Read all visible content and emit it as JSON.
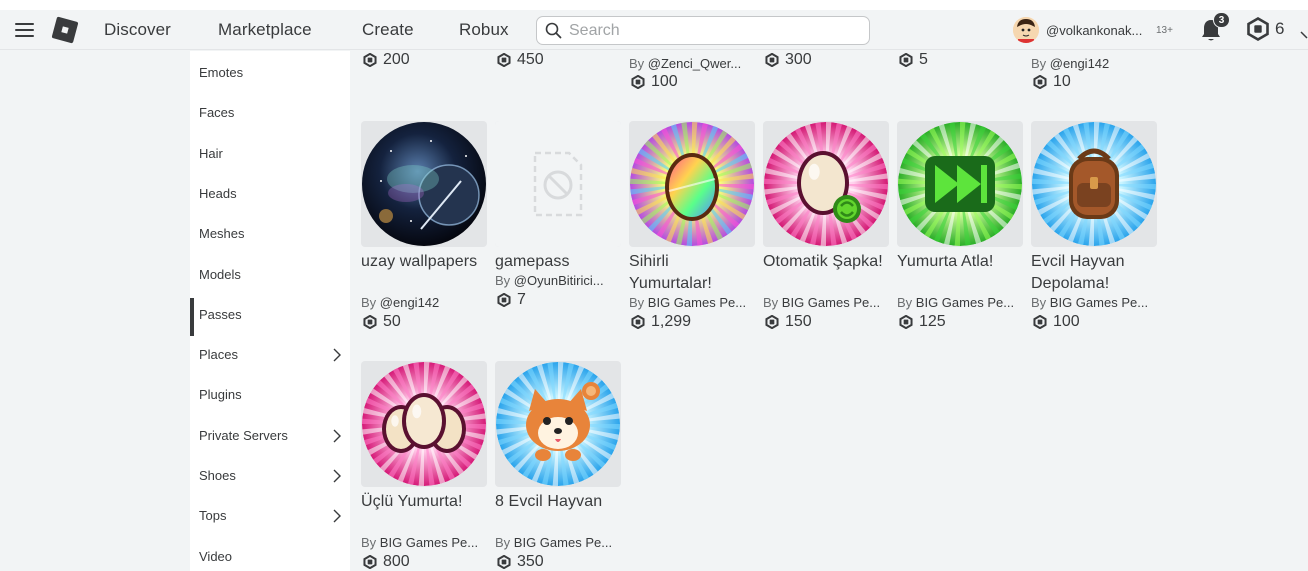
{
  "header": {
    "nav": [
      "Discover",
      "Marketplace",
      "Create",
      "Robux"
    ],
    "search_placeholder": "Search",
    "username": "@volkankonak...",
    "age_badge": "13+",
    "notifications": "3",
    "robux": "6"
  },
  "sidebar": {
    "items": [
      {
        "label": "Emotes",
        "chevron": false,
        "active": false
      },
      {
        "label": "Faces",
        "chevron": false,
        "active": false
      },
      {
        "label": "Hair",
        "chevron": false,
        "active": false
      },
      {
        "label": "Heads",
        "chevron": false,
        "active": false
      },
      {
        "label": "Meshes",
        "chevron": false,
        "active": false
      },
      {
        "label": "Models",
        "chevron": false,
        "active": false
      },
      {
        "label": "Passes",
        "chevron": false,
        "active": true
      },
      {
        "label": "Places",
        "chevron": true,
        "active": false
      },
      {
        "label": "Plugins",
        "chevron": false,
        "active": false
      },
      {
        "label": "Private Servers",
        "chevron": true,
        "active": false
      },
      {
        "label": "Shoes",
        "chevron": true,
        "active": false
      },
      {
        "label": "Tops",
        "chevron": true,
        "active": false
      },
      {
        "label": "Video",
        "chevron": false,
        "active": false
      }
    ]
  },
  "partial_row": [
    {
      "price": "200"
    },
    {
      "price": "450"
    },
    {
      "by": "By",
      "creator": "@Zenci_Qwer...",
      "price": "100"
    },
    {
      "price": "300"
    },
    {
      "price": "5"
    },
    {
      "by": "By",
      "creator": "@engi142",
      "price": "10"
    }
  ],
  "items": [
    {
      "name": "uzay wallpapers",
      "by": "By",
      "creator": "@engi142",
      "price": "50",
      "art": "space"
    },
    {
      "name": "gamepass",
      "by": "By",
      "creator": "@OyunBitirici...",
      "price": "7",
      "art": "placeholder"
    },
    {
      "name": "Sihirli Yumurtalar!",
      "by": "By",
      "creator": "BIG Games Pe...",
      "price": "1,299",
      "art": "rainbow-egg"
    },
    {
      "name": "Otomatik Şapka!",
      "by": "By",
      "creator": "BIG Games Pe...",
      "price": "150",
      "art": "auto-egg"
    },
    {
      "name": "Yumurta Atla!",
      "by": "By",
      "creator": "BIG Games Pe...",
      "price": "125",
      "art": "skip"
    },
    {
      "name": "Evcil Hayvan Depolama!",
      "by": "By",
      "creator": "BIG Games Pe...",
      "price": "100",
      "art": "backpack"
    },
    {
      "name": "Üçlü Yumurta!",
      "by": "By",
      "creator": "BIG Games Pe...",
      "price": "800",
      "art": "triple-egg"
    },
    {
      "name": "8 Evcil Hayvan",
      "by": "By",
      "creator": "BIG Games Pe...",
      "price": "350",
      "art": "corgi"
    }
  ],
  "colors": {
    "text": "#393b3d",
    "muted": "#6b6e70",
    "bg": "#f2f4f5"
  }
}
